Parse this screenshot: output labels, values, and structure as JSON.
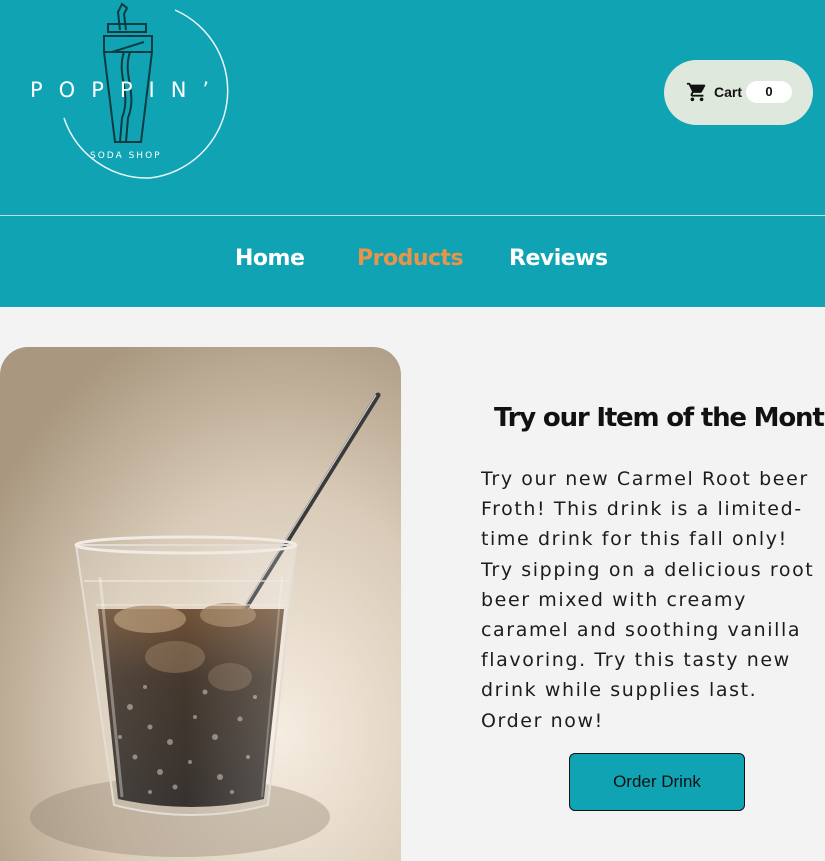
{
  "brand": {
    "name": "POPPIN’",
    "tagline": "SODA SHOP"
  },
  "cart": {
    "label": "Cart",
    "count": "0",
    "icon": "shopping-cart-icon"
  },
  "nav": {
    "items": [
      {
        "label": "Home",
        "active": false
      },
      {
        "label": "Products",
        "active": true
      },
      {
        "label": "Reviews",
        "active": false
      }
    ]
  },
  "feature": {
    "title": "Try our Item of the Month!",
    "body": "Try our new Carmel Root beer Froth! This drink is a limited-time drink for this fall only! Try sipping on a delicious root beer mixed with creamy caramel and soothing vanilla flavoring. Try this tasty new drink while supplies last. Order now!",
    "button_label": "Order Drink"
  },
  "colors": {
    "primary": "#10a3b3",
    "accent": "#e8944a",
    "background": "#f3f3f3",
    "cart_pill": "#dfe8dc"
  }
}
